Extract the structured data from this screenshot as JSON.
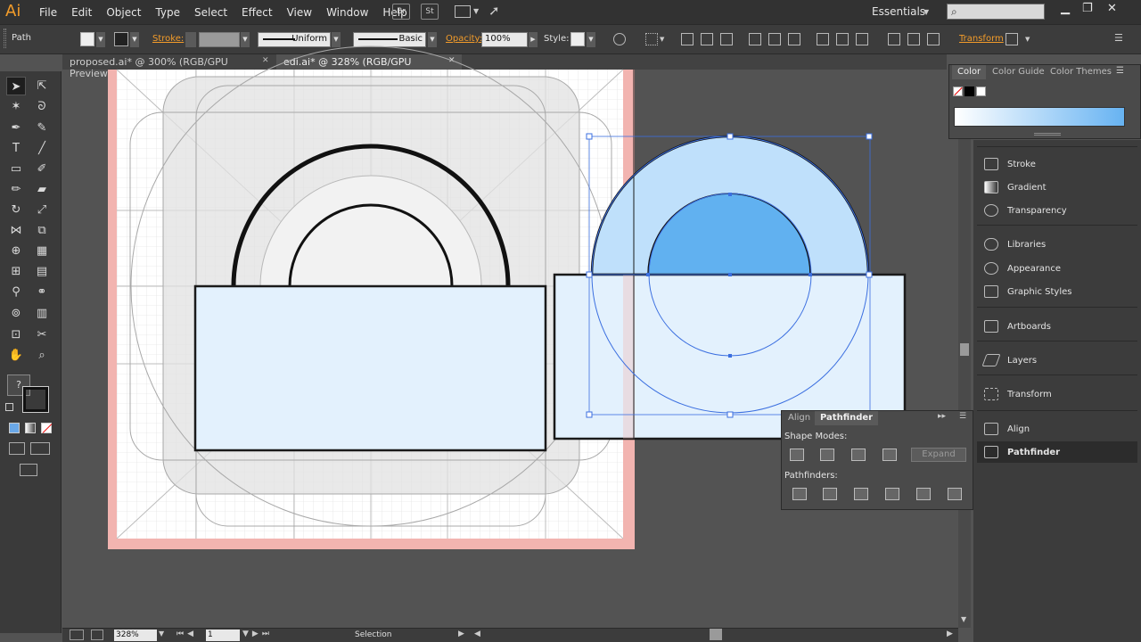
{
  "app": {
    "logo": "Ai"
  },
  "menu": [
    "File",
    "Edit",
    "Object",
    "Type",
    "Select",
    "Effect",
    "View",
    "Window",
    "Help"
  ],
  "menubar_icons": {
    "bridge": "Br",
    "stock": "St"
  },
  "workspace": "Essentials",
  "control_bar": {
    "selection_type": "Path",
    "stroke_label": "Stroke:",
    "stroke_profile": "Uniform",
    "brush": "Basic",
    "opacity_label": "Opacity:",
    "opacity_value": "100%",
    "style_label": "Style:",
    "transform_label": "Transform"
  },
  "tabs": [
    {
      "label": "proposed.ai* @ 300% (RGB/GPU Preview)",
      "close": "✕",
      "active": false
    },
    {
      "label": "edi.ai* @ 328% (RGB/GPU Preview)",
      "close": "✕",
      "active": true
    }
  ],
  "tools_misc": {
    "unknown_fill": "?"
  },
  "status": {
    "zoom": "328%",
    "page": "1",
    "mode": "Selection"
  },
  "color_panel": {
    "tabs": [
      "Color",
      "Color Guide",
      "Color Themes"
    ],
    "gradient_start": "#ffffff",
    "gradient_end": "#67b3f2"
  },
  "dock": [
    {
      "label": "Stroke",
      "icon": "stroke-icon"
    },
    {
      "label": "Gradient",
      "icon": "gradient-icon"
    },
    {
      "label": "Transparency",
      "icon": "transparency-icon"
    },
    {
      "label": "Libraries",
      "icon": "libraries-icon"
    },
    {
      "label": "Appearance",
      "icon": "appearance-icon"
    },
    {
      "label": "Graphic Styles",
      "icon": "graphic-styles-icon"
    },
    {
      "label": "Artboards",
      "icon": "artboards-icon"
    },
    {
      "label": "Layers",
      "icon": "layers-icon"
    },
    {
      "label": "Transform",
      "icon": "transform-icon"
    },
    {
      "label": "Align",
      "icon": "align-icon"
    },
    {
      "label": "Pathfinder",
      "icon": "pathfinder-icon"
    }
  ],
  "pathfinder_panel": {
    "tabs": [
      "Align",
      "Pathfinder"
    ],
    "shape_modes_label": "Shape Modes:",
    "pathfinders_label": "Pathfinders:",
    "expand_label": "Expand"
  },
  "colors": {
    "shape_fill_light": "#e3f1fd",
    "shape_fill_mid": "#bfe0fb",
    "shape_fill_dark": "#61b1f0",
    "selection": "#3b6fe0",
    "accent": "#f39c2a"
  }
}
